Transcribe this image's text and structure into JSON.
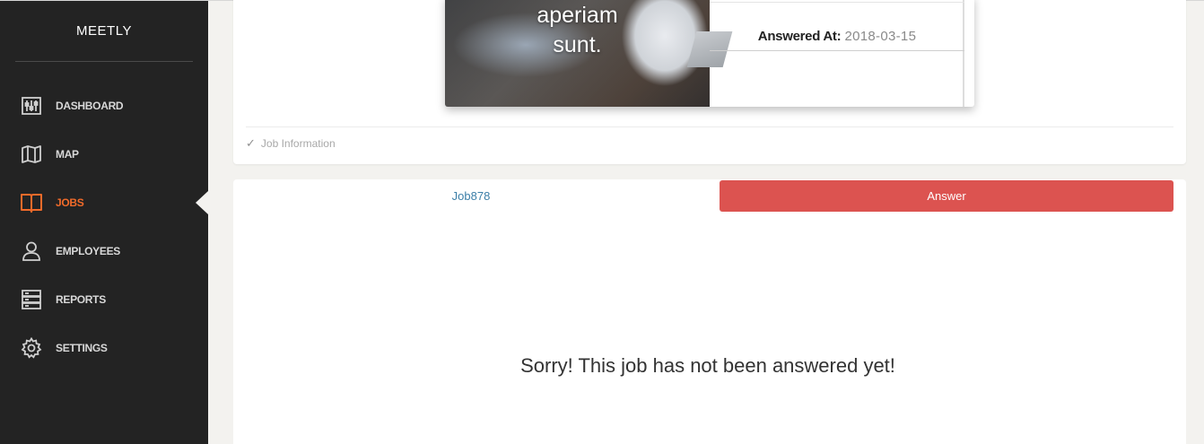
{
  "sidebar": {
    "brand": "MEETLY",
    "items": [
      {
        "label": "DASHBOARD",
        "icon": "dashboard-icon",
        "active": false
      },
      {
        "label": "MAP",
        "icon": "map-icon",
        "active": false
      },
      {
        "label": "JOBS",
        "icon": "book-icon",
        "active": true
      },
      {
        "label": "EMPLOYEES",
        "icon": "user-icon",
        "active": false
      },
      {
        "label": "REPORTS",
        "icon": "server-icon",
        "active": false
      },
      {
        "label": "SETTINGS",
        "icon": "gear-icon",
        "active": false
      }
    ]
  },
  "job_card": {
    "caption_line1": "aperiam",
    "caption_line2": "sunt.",
    "answered_label": "Answered At:",
    "answered_date": "2018-03-15",
    "section_label": "Job Information"
  },
  "answer_panel": {
    "tab_job": "Job878",
    "tab_answer": "Answer",
    "empty_message": "Sorry! This job has not been answered yet!"
  },
  "colors": {
    "sidebar_bg": "#232323",
    "active": "#f26b2a",
    "answer_button": "#dc5350",
    "link": "#3c7fa8"
  }
}
